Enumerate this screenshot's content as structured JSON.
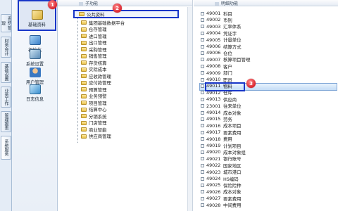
{
  "vertical_tabs": [
    {
      "label": "系统\n管理"
    },
    {
      "label": "财务会计"
    },
    {
      "label": "基础设置"
    },
    {
      "label": "业务工作"
    },
    {
      "label": "管理报表"
    },
    {
      "label": "系统服务"
    }
  ],
  "nav": {
    "active_label": "基础资料",
    "items": [
      {
        "label": "初始化"
      },
      {
        "label": "系统设置"
      },
      {
        "label": "用户管理"
      },
      {
        "label": "日志信息"
      }
    ]
  },
  "left_panel": {
    "header": "子功能",
    "root": "公共资料",
    "items": [
      "集团基础数据平台",
      "仓存管理",
      "进口管理",
      "出口管理",
      "采购管理",
      "销售管理",
      "存货核算",
      "实际成本",
      "应收款管理",
      "应付款管理",
      "预算管理",
      "业务预警",
      "项目管理",
      "结算中心",
      "分销系统",
      "门店管理",
      "商业智能",
      "供应商管理"
    ]
  },
  "right_panel": {
    "header": "明细功能",
    "rows": [
      {
        "code": "49001",
        "name": "科目"
      },
      {
        "code": "49002",
        "name": "币别"
      },
      {
        "code": "49003",
        "name": "汇率体系"
      },
      {
        "code": "49004",
        "name": "凭证字"
      },
      {
        "code": "49005",
        "name": "计量单位"
      },
      {
        "code": "49006",
        "name": "结算方式"
      },
      {
        "code": "49006",
        "name": "仓位"
      },
      {
        "code": "49007",
        "name": "核算项目管理"
      },
      {
        "code": "49008",
        "name": "客户"
      },
      {
        "code": "49009",
        "name": "部门"
      },
      {
        "code": "49010",
        "name": "职员"
      },
      {
        "code": "49011",
        "name": "物料"
      },
      {
        "code": "49012",
        "name": "仓库"
      },
      {
        "code": "49013",
        "name": "供应商"
      },
      {
        "code": "23001",
        "name": "往来单位"
      },
      {
        "code": "49014",
        "name": "成本对象"
      },
      {
        "code": "49015",
        "name": "劳务"
      },
      {
        "code": "49016",
        "name": "成本项目"
      },
      {
        "code": "49017",
        "name": "要素费用"
      },
      {
        "code": "49018",
        "name": "费用"
      },
      {
        "code": "49019",
        "name": "计划项目"
      },
      {
        "code": "49020",
        "name": "成本对象组"
      },
      {
        "code": "49021",
        "name": "银行账号"
      },
      {
        "code": "49022",
        "name": "国家地区"
      },
      {
        "code": "49023",
        "name": "城市港口"
      },
      {
        "code": "49024",
        "name": "HS编码"
      },
      {
        "code": "49025",
        "name": "保险险种"
      },
      {
        "code": "49026",
        "name": "成本对象"
      },
      {
        "code": "49027",
        "name": "要素费用"
      },
      {
        "code": "49028",
        "name": "中间费用"
      }
    ]
  },
  "badges": [
    "1",
    "2",
    "3"
  ],
  "colors": {
    "highlight": "#1836c8",
    "badge": "#d9232e",
    "selected_row": "#c3dcf6"
  }
}
